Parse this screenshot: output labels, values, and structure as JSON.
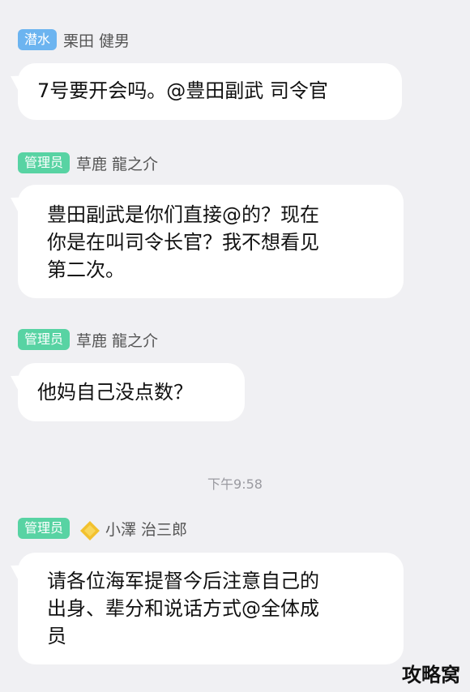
{
  "messages": [
    {
      "badge": "潜水",
      "sender": "栗田 健男",
      "text": "7号要开会吗。@豊田副武 司令官"
    },
    {
      "badge": "管理员",
      "sender": "草鹿 龍之介",
      "text_lines": [
        "豊田副武是你们直接@的？现在",
        "你是在叫司令长官？我不想看见",
        "第二次。"
      ]
    },
    {
      "badge": "管理员",
      "sender": "草鹿 龍之介",
      "text": "他妈自己没点数？"
    },
    {
      "badge": "管理员",
      "sender": "小澤 治三郎",
      "text_lines": [
        "请各位海军提督今后注意自己的",
        "出身、辈分和说话方式@全体成",
        "员"
      ]
    }
  ],
  "timestamp": "下午9:58",
  "watermark": "攻略窝",
  "colors": {
    "background": "#f0f0f3",
    "badge_blue": "#6cb4f0",
    "badge_green": "#58d3a3",
    "bubble": "#ffffff"
  },
  "icons": {
    "rank": "diamond-rank-icon"
  }
}
